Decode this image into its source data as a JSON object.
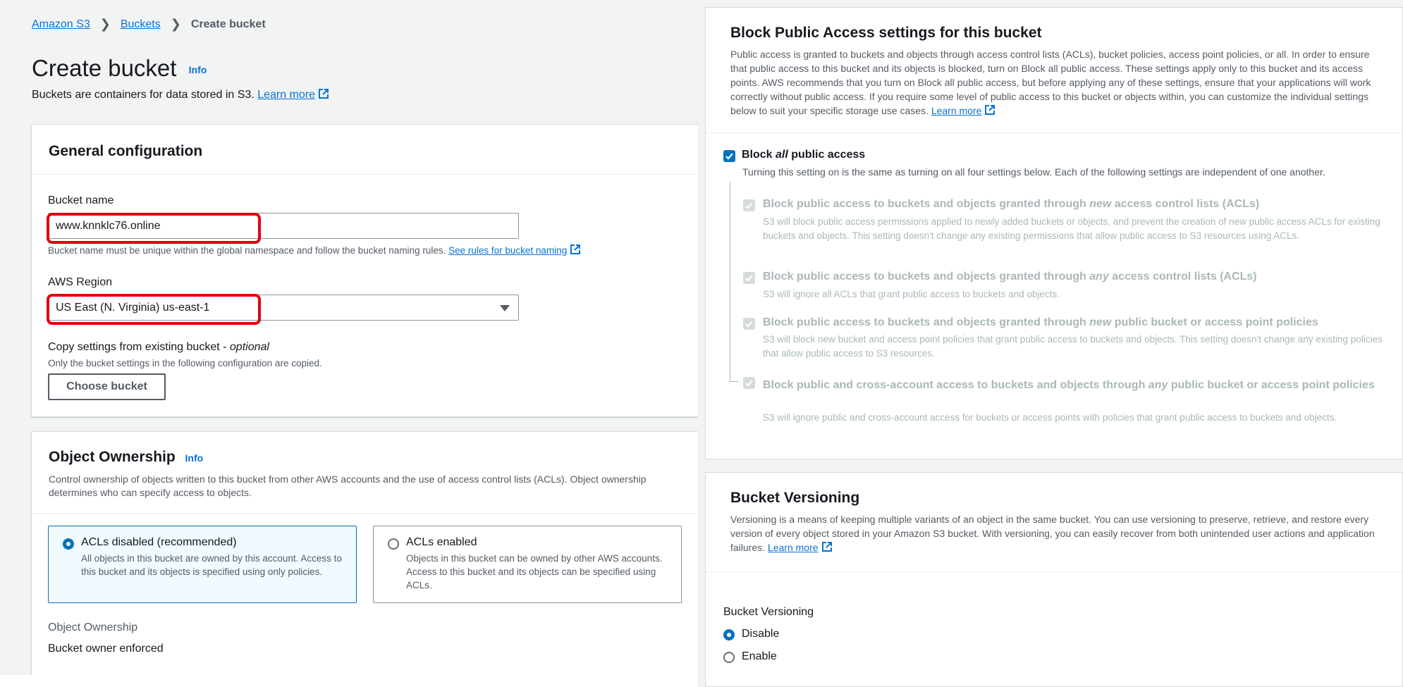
{
  "breadcrumb": {
    "home": "Amazon S3",
    "buckets": "Buckets",
    "current": "Create bucket"
  },
  "page": {
    "title": "Create bucket",
    "info": "Info",
    "desc": "Buckets are containers for data stored in S3.",
    "learn_more": "Learn more"
  },
  "general": {
    "title": "General configuration",
    "bucket_name_label": "Bucket name",
    "bucket_name_value": "www.knnklc76.online",
    "bucket_name_hint": "Bucket name must be unique within the global namespace and follow the bucket naming rules.",
    "bucket_name_rules_link": "See rules for bucket naming",
    "region_label": "AWS Region",
    "region_value": "US East (N. Virginia) us-east-1",
    "copy_label": "Copy settings from existing bucket - ",
    "copy_optional": "optional",
    "copy_hint": "Only the bucket settings in the following configuration are copied.",
    "choose_bucket": "Choose bucket"
  },
  "ownership": {
    "title": "Object Ownership",
    "info": "Info",
    "desc": "Control ownership of objects written to this bucket from other AWS accounts and the use of access control lists (ACLs). Object ownership determines who can specify access to objects.",
    "options": [
      {
        "title": "ACLs disabled (recommended)",
        "desc": "All objects in this bucket are owned by this account. Access to this bucket and its objects is specified using only policies.",
        "selected": true
      },
      {
        "title": "ACLs enabled",
        "desc": "Objects in this bucket can be owned by other AWS accounts. Access to this bucket and its objects can be specified using ACLs.",
        "selected": false
      }
    ],
    "field_label": "Object Ownership",
    "field_value": "Bucket owner enforced"
  },
  "bpa": {
    "title": "Block Public Access settings for this bucket",
    "desc": "Public access is granted to buckets and objects through access control lists (ACLs), bucket policies, access point policies, or all. In order to ensure that public access to this bucket and its objects is blocked, turn on Block all public access. These settings apply only to this bucket and its access points. AWS recommends that you turn on Block all public access, but before applying any of these settings, ensure that your applications will work correctly without public access. If you require some level of public access to this bucket or objects within, you can customize the individual settings below to suit your specific storage use cases.",
    "learn_more": "Learn more",
    "main": {
      "label_pre": "Block ",
      "label_em": "all",
      "label_post": " public access",
      "desc": "Turning this setting on is the same as turning on all four settings below. Each of the following settings are independent of one another.",
      "checked": true
    },
    "options": [
      {
        "pre": "Block public access to buckets and objects granted through ",
        "em": "new",
        "post": " access control lists (ACLs)",
        "desc": "S3 will block public access permissions applied to newly added buckets or objects, and prevent the creation of new public access ACLs for existing buckets and objects. This setting doesn't change any existing permissions that allow public access to S3 resources using ACLs."
      },
      {
        "pre": "Block public access to buckets and objects granted through ",
        "em": "any",
        "post": " access control lists (ACLs)",
        "desc": "S3 will ignore all ACLs that grant public access to buckets and objects."
      },
      {
        "pre": "Block public access to buckets and objects granted through ",
        "em": "new",
        "post": " public bucket or access point policies",
        "desc": "S3 will block new bucket and access point policies that grant public access to buckets and objects. This setting doesn't change any existing policies that allow public access to S3 resources."
      },
      {
        "pre": "Block public and cross-account access to buckets and objects through ",
        "em": "any",
        "post": " public bucket or access point policies",
        "desc": "S3 will ignore public and cross-account access for buckets or access points with policies that grant public access to buckets and objects."
      }
    ]
  },
  "versioning": {
    "title": "Bucket Versioning",
    "desc": "Versioning is a means of keeping multiple variants of an object in the same bucket. You can use versioning to preserve, retrieve, and restore every version of every object stored in your Amazon S3 bucket. With versioning, you can easily recover from both unintended user actions and application failures.",
    "learn_more": "Learn more",
    "field_label": "Bucket Versioning",
    "options": [
      {
        "label": "Disable",
        "selected": true
      },
      {
        "label": "Enable",
        "selected": false
      }
    ]
  },
  "colors": {
    "link": "#0972d3",
    "primary": "#0073bb",
    "highlight": "#e3000f",
    "disabled": "#aab7b8"
  },
  "icons": {
    "external": "external-link-icon",
    "check": "check-icon",
    "caret": "caret-down-icon",
    "chevron": "chevron-right-icon"
  }
}
